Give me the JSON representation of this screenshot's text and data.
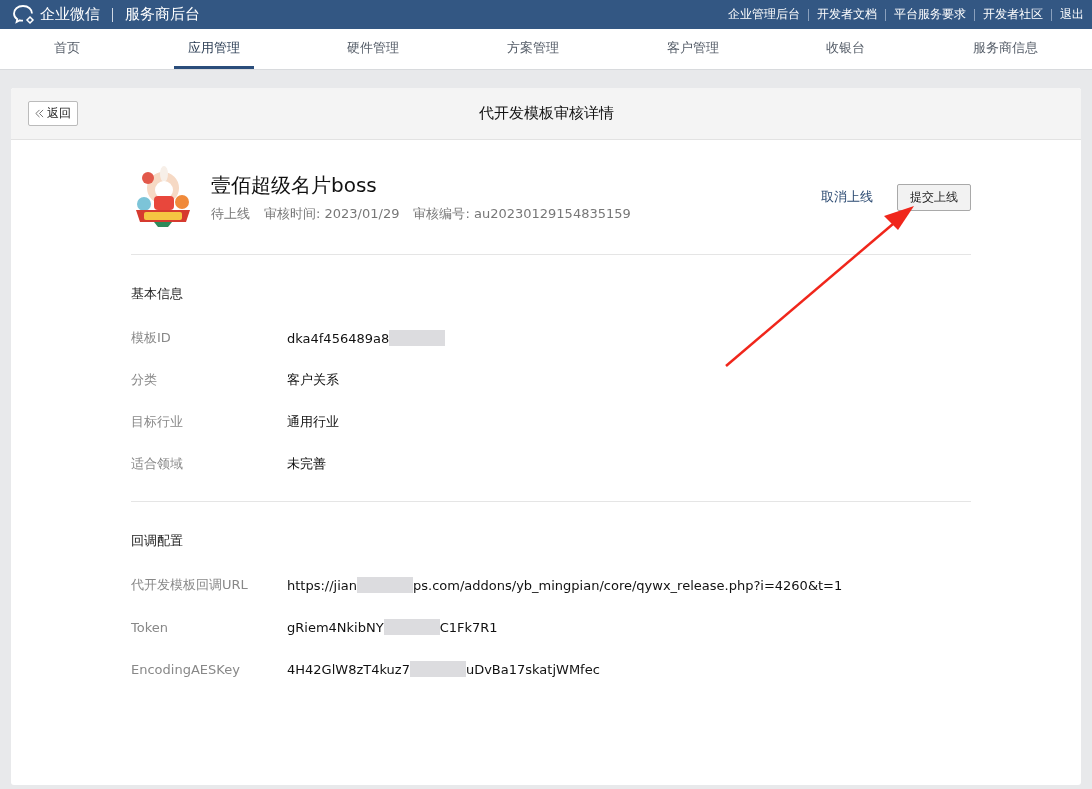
{
  "top_bar": {
    "logo_text": "企业微信",
    "subtitle": "服务商后台",
    "links": [
      "企业管理后台",
      "开发者文档",
      "平台服务要求",
      "开发者社区",
      "退出"
    ]
  },
  "nav": [
    {
      "label": "首页",
      "selected": false
    },
    {
      "label": "应用管理",
      "selected": true
    },
    {
      "label": "硬件管理",
      "selected": false
    },
    {
      "label": "方案管理",
      "selected": false
    },
    {
      "label": "客户管理",
      "selected": false
    },
    {
      "label": "收银台",
      "selected": false
    },
    {
      "label": "服务商信息",
      "selected": false
    }
  ],
  "card": {
    "back_button": "返回",
    "title": "代开发模板审核详情"
  },
  "app": {
    "name": "壹佰超级名片boss",
    "status": "待上线",
    "review_time": "审核时间: 2023/01/29",
    "review_no": "审核编号: au20230129154835159",
    "cancel_link": "取消上线",
    "submit_button": "提交上线"
  },
  "sections": [
    {
      "title": "基本信息",
      "rows": [
        {
          "label": "模板ID",
          "parts": [
            {
              "kind": "text",
              "text": "dka4f456489a8"
            },
            {
              "kind": "redaction"
            }
          ]
        },
        {
          "label": "分类",
          "parts": [
            {
              "kind": "text",
              "text": "客户关系"
            }
          ]
        },
        {
          "label": "目标行业",
          "parts": [
            {
              "kind": "text",
              "text": "通用行业"
            }
          ]
        },
        {
          "label": "适合领域",
          "parts": [
            {
              "kind": "text",
              "text": "未完善"
            }
          ]
        }
      ]
    },
    {
      "title": "回调配置",
      "rows": [
        {
          "label": "代开发模板回调URL",
          "parts": [
            {
              "kind": "text",
              "text": "https://jian"
            },
            {
              "kind": "redaction"
            },
            {
              "kind": "text",
              "text": "ps.com/addons/yb_mingpian/core/qywx_release.php?i=4260&t=1"
            }
          ]
        },
        {
          "label": "Token",
          "parts": [
            {
              "kind": "text",
              "text": "gRiem4NkibNY"
            },
            {
              "kind": "redaction"
            },
            {
              "kind": "text",
              "text": "C1Fk7R1"
            }
          ]
        },
        {
          "label": "EncodingAESKey",
          "parts": [
            {
              "kind": "text",
              "text": "4H42GlW8zT4kuz7"
            },
            {
              "kind": "redaction"
            },
            {
              "kind": "text",
              "text": "uDvBa17skatjWMfec"
            }
          ]
        }
      ]
    }
  ],
  "annotation": {
    "kind": "arrow"
  }
}
